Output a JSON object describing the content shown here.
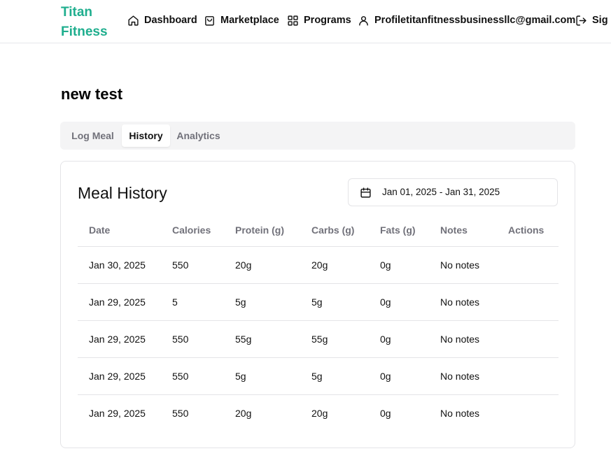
{
  "brand": {
    "name": "Titan Fitness",
    "color": "#1fae8e"
  },
  "nav": {
    "dashboard": "Dashboard",
    "marketplace": "Marketplace",
    "programs": "Programs",
    "profile": "Profiletitanfitnessbusinessllc@gmail.com",
    "signout": "Sig"
  },
  "page": {
    "title": "new test"
  },
  "tabs": [
    {
      "label": "Log Meal",
      "active": false
    },
    {
      "label": "History",
      "active": true
    },
    {
      "label": "Analytics",
      "active": false
    }
  ],
  "history": {
    "title": "Meal History",
    "date_range": "Jan 01, 2025 - Jan 31, 2025",
    "columns": [
      "Date",
      "Calories",
      "Protein (g)",
      "Carbs (g)",
      "Fats (g)",
      "Notes",
      "Actions"
    ],
    "rows": [
      [
        "Jan 30, 2025",
        "550",
        "20g",
        "20g",
        "0g",
        "No notes",
        ""
      ],
      [
        "Jan 29, 2025",
        "5",
        "5g",
        "5g",
        "0g",
        "No notes",
        ""
      ],
      [
        "Jan 29, 2025",
        "550",
        "55g",
        "55g",
        "0g",
        "No notes",
        ""
      ],
      [
        "Jan 29, 2025",
        "550",
        "5g",
        "5g",
        "0g",
        "No notes",
        ""
      ],
      [
        "Jan 29, 2025",
        "550",
        "20g",
        "20g",
        "0g",
        "No notes",
        ""
      ]
    ]
  }
}
